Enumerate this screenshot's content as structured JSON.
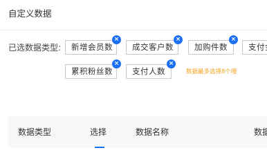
{
  "header": {
    "title": "自定义数据"
  },
  "selection": {
    "label": "已选数据类型:",
    "tags": [
      {
        "label": "新增会员数",
        "remove_glyph": "×"
      },
      {
        "label": "成交客户数",
        "remove_glyph": "×"
      },
      {
        "label": "加购件数",
        "remove_glyph": "×"
      },
      {
        "label": "支付金额",
        "remove_glyph": "×"
      },
      {
        "label": "累积粉丝数",
        "remove_glyph": "×"
      },
      {
        "label": "支付人数",
        "remove_glyph": "×"
      }
    ],
    "hint": "数据最多选择8个哦",
    "hint_color": "#f5a623"
  },
  "table": {
    "columns": [
      "数据类型",
      "选择",
      "数据名称",
      "数据"
    ]
  },
  "colors": {
    "accent": "#1b6ff3"
  }
}
